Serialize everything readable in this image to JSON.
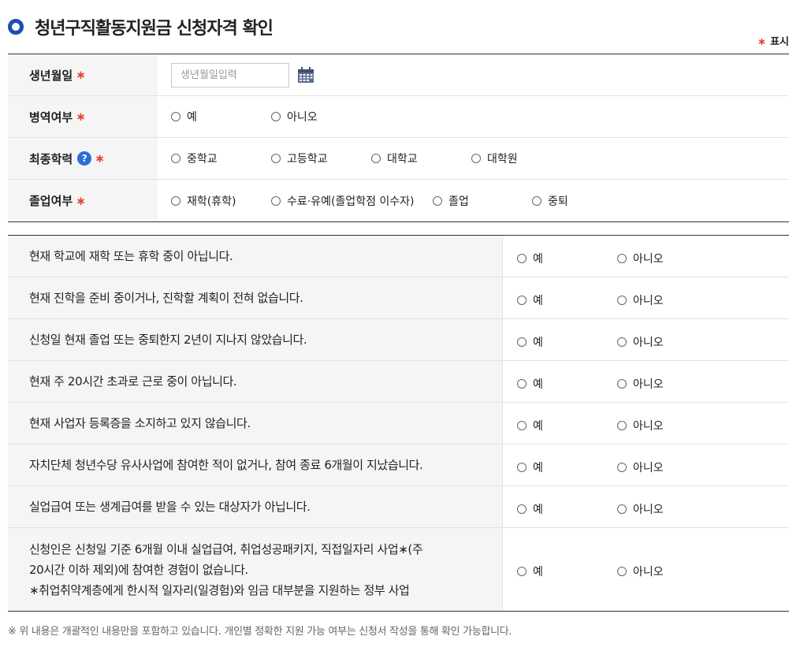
{
  "header": {
    "title": "청년구직활동지원금 신청자격 확인",
    "required_note": "표시",
    "required_star": "∗"
  },
  "colors": {
    "accent": "#1b4fb0",
    "required": "#e6412b",
    "help": "#2a6fd6"
  },
  "form": {
    "birth": {
      "label": "생년월일",
      "star": "∗",
      "placeholder": "생년월일입력",
      "icon": "calendar-icon"
    },
    "military": {
      "label": "병역여부",
      "star": "∗",
      "options": [
        "예",
        "아니오"
      ]
    },
    "education": {
      "label": "최종학력",
      "help": "?",
      "star": "∗",
      "options": [
        "중학교",
        "고등학교",
        "대학교",
        "대학원"
      ]
    },
    "graduation": {
      "label": "졸업여부",
      "star": "∗",
      "options": [
        "재학(휴학)",
        "수료·유예(졸업학점 이수자)",
        "졸업",
        "중퇴"
      ]
    }
  },
  "questions": {
    "yes": "예",
    "no": "아니오",
    "items": [
      {
        "text": "현재 학교에 재학 또는 휴학 중이 아닙니다."
      },
      {
        "text": "현재 진학을 준비 중이거나, 진학할 계획이 전혀 없습니다."
      },
      {
        "text": "신청일 현재 졸업 또는 중퇴한지 2년이 지나지 않았습니다."
      },
      {
        "text": "현재 주 20시간 초과로 근로 중이 아닙니다."
      },
      {
        "text": "현재 사업자 등록증을 소지하고 있지 않습니다."
      },
      {
        "text": "자치단체 청년수당 유사사업에 참여한 적이 없거나, 참여 종료 6개월이 지났습니다."
      },
      {
        "text": "실업급여 또는 생계급여를 받을 수 있는 대상자가 아닙니다."
      },
      {
        "line1": "신청인은 신청일 기준 6개월 이내 실업급여, 취업성공패키지, 직접일자리 사업∗(주",
        "line2": "20시간 이하 제외)에 참여한 경험이 없습니다.",
        "line3": "∗취업취약계층에게 한시적 일자리(일경험)와 임금 대부분을 지원하는 정부 사업"
      }
    ]
  },
  "footnote": "※ 위 내용은 개괄적인 내용만을 포함하고 있습니다. 개인별 정확한 지원 가능 여부는 신청서 작성을 통해 확인 가능합니다."
}
